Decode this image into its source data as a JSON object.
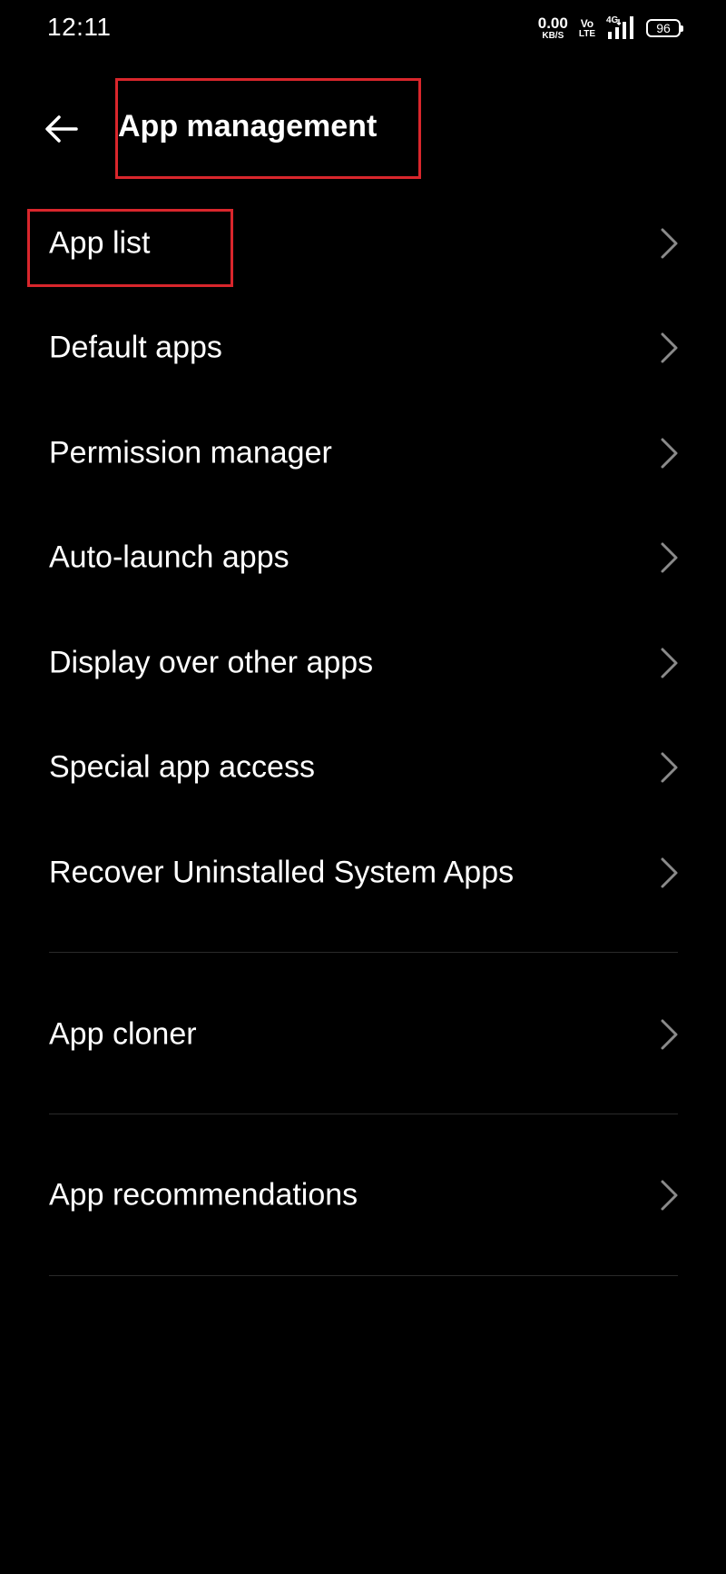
{
  "status_bar": {
    "time": "12:11",
    "net_speed_value": "0.00",
    "net_speed_unit": "KB/S",
    "volte_top": "Vo",
    "volte_bottom": "LTE",
    "network_type": "4G",
    "battery_level": "96"
  },
  "header": {
    "back_icon": "arrow-left-icon",
    "title": "App management"
  },
  "menu": {
    "items": [
      {
        "label": "App list",
        "icon": "chevron-right-icon"
      },
      {
        "label": "Default apps",
        "icon": "chevron-right-icon"
      },
      {
        "label": "Permission manager",
        "icon": "chevron-right-icon"
      },
      {
        "label": "Auto-launch apps",
        "icon": "chevron-right-icon"
      },
      {
        "label": "Display over other apps",
        "icon": "chevron-right-icon"
      },
      {
        "label": "Special app access",
        "icon": "chevron-right-icon"
      },
      {
        "label": "Recover Uninstalled System Apps",
        "icon": "chevron-right-icon"
      },
      {
        "label": "App cloner",
        "icon": "chevron-right-icon"
      },
      {
        "label": "App recommendations",
        "icon": "chevron-right-icon"
      }
    ]
  },
  "colors": {
    "background": "#000000",
    "text": "#ffffff",
    "chevron": "#8a8a8a",
    "divider": "#2a2a2a",
    "highlight": "#d9262c"
  }
}
